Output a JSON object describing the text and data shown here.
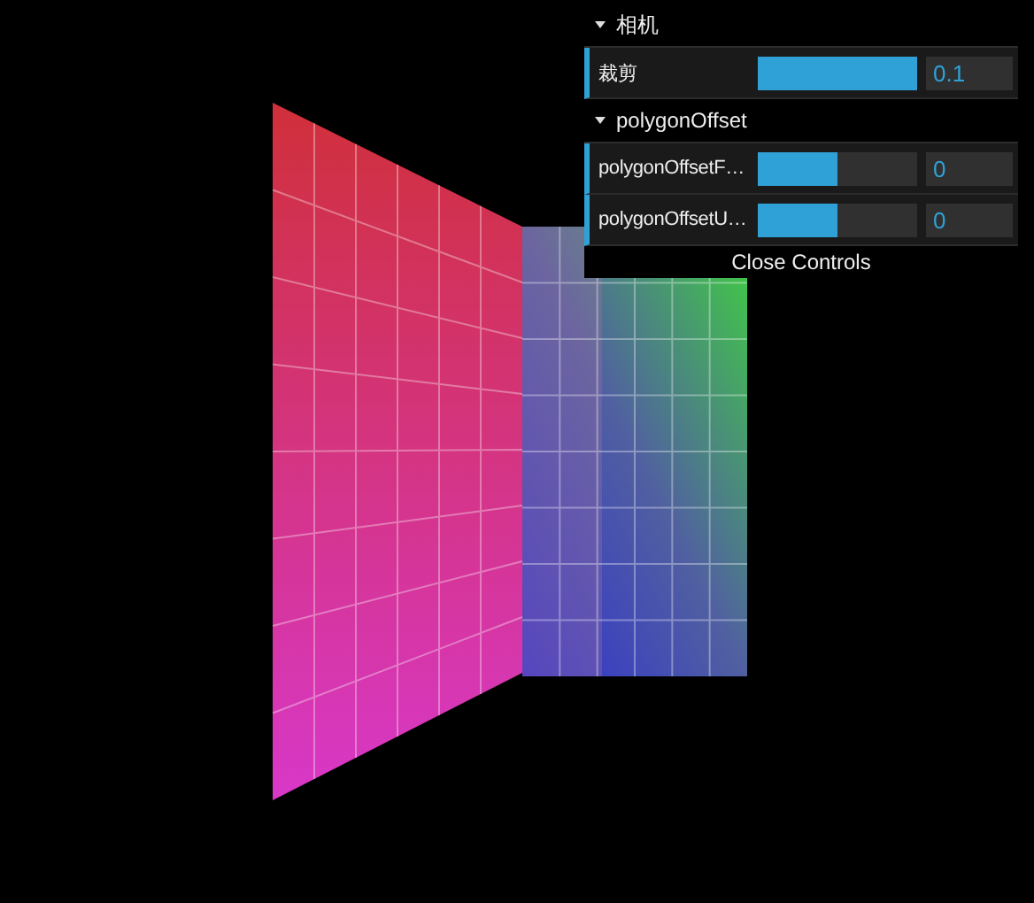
{
  "controls": {
    "folders": [
      {
        "title": "相机",
        "expanded": true,
        "controllers": [
          {
            "label": "裁剪",
            "level": 1,
            "value": "0.1"
          }
        ]
      },
      {
        "title": "polygonOffset",
        "expanded": true,
        "controllers": [
          {
            "label": "polygonOffsetF…",
            "level": 0.5,
            "value": "0"
          },
          {
            "label": "polygonOffsetU…",
            "level": 0.5,
            "value": "0"
          }
        ]
      }
    ],
    "close_button": "Close Controls"
  }
}
